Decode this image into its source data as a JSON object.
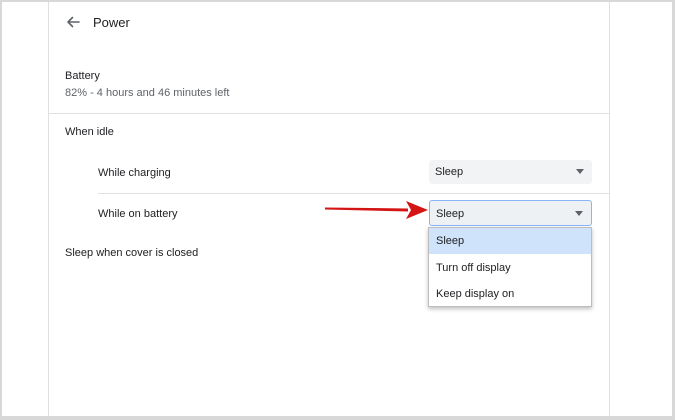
{
  "header": {
    "title": "Power"
  },
  "battery": {
    "title": "Battery",
    "status": "82% - 4 hours and 46 minutes left"
  },
  "idle": {
    "heading": "When idle",
    "charging": {
      "label": "While charging",
      "value": "Sleep"
    },
    "on_battery": {
      "label": "While on battery",
      "value": "Sleep"
    }
  },
  "dropdown": {
    "options": [
      "Sleep",
      "Turn off display",
      "Keep display on"
    ],
    "selected": "Sleep"
  },
  "cover": {
    "label": "Sleep when cover is closed"
  },
  "colors": {
    "annotation_arrow": "#d41515",
    "selected_option_bg": "#cfe3fa",
    "focus_border": "#8ab4f8"
  },
  "icons": {
    "back": "arrow-left-icon",
    "caret": "caret-down-icon"
  }
}
